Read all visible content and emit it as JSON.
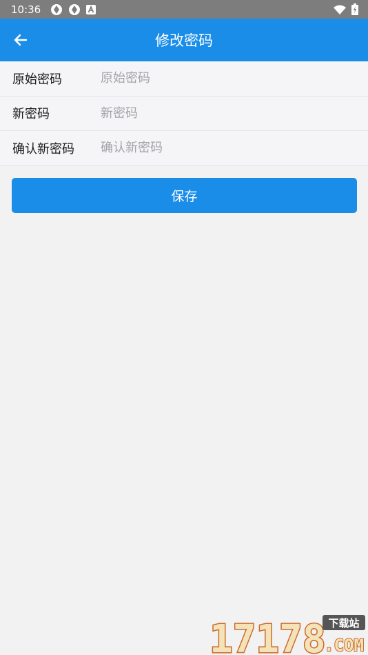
{
  "status_bar": {
    "time": "10:36",
    "icons": [
      "sync-icon",
      "sync-icon",
      "notification-a-icon"
    ],
    "right_icons": [
      "wifi-icon",
      "battery-charging-icon"
    ]
  },
  "header": {
    "title": "修改密码",
    "back_icon": "arrow-left-icon"
  },
  "form": {
    "fields": [
      {
        "label": "原始密码",
        "placeholder": "原始密码",
        "value": ""
      },
      {
        "label": "新密码",
        "placeholder": "新密码",
        "value": ""
      },
      {
        "label": "确认新密码",
        "placeholder": "确认新密码",
        "value": ""
      }
    ]
  },
  "save_label": "保存",
  "watermark": {
    "number": "17178",
    "badge": "下载站",
    "domain": ".COM"
  },
  "colors": {
    "primary": "#1a8de9",
    "status_bar": "#7d7d7d",
    "background": "#f2f2f3"
  }
}
